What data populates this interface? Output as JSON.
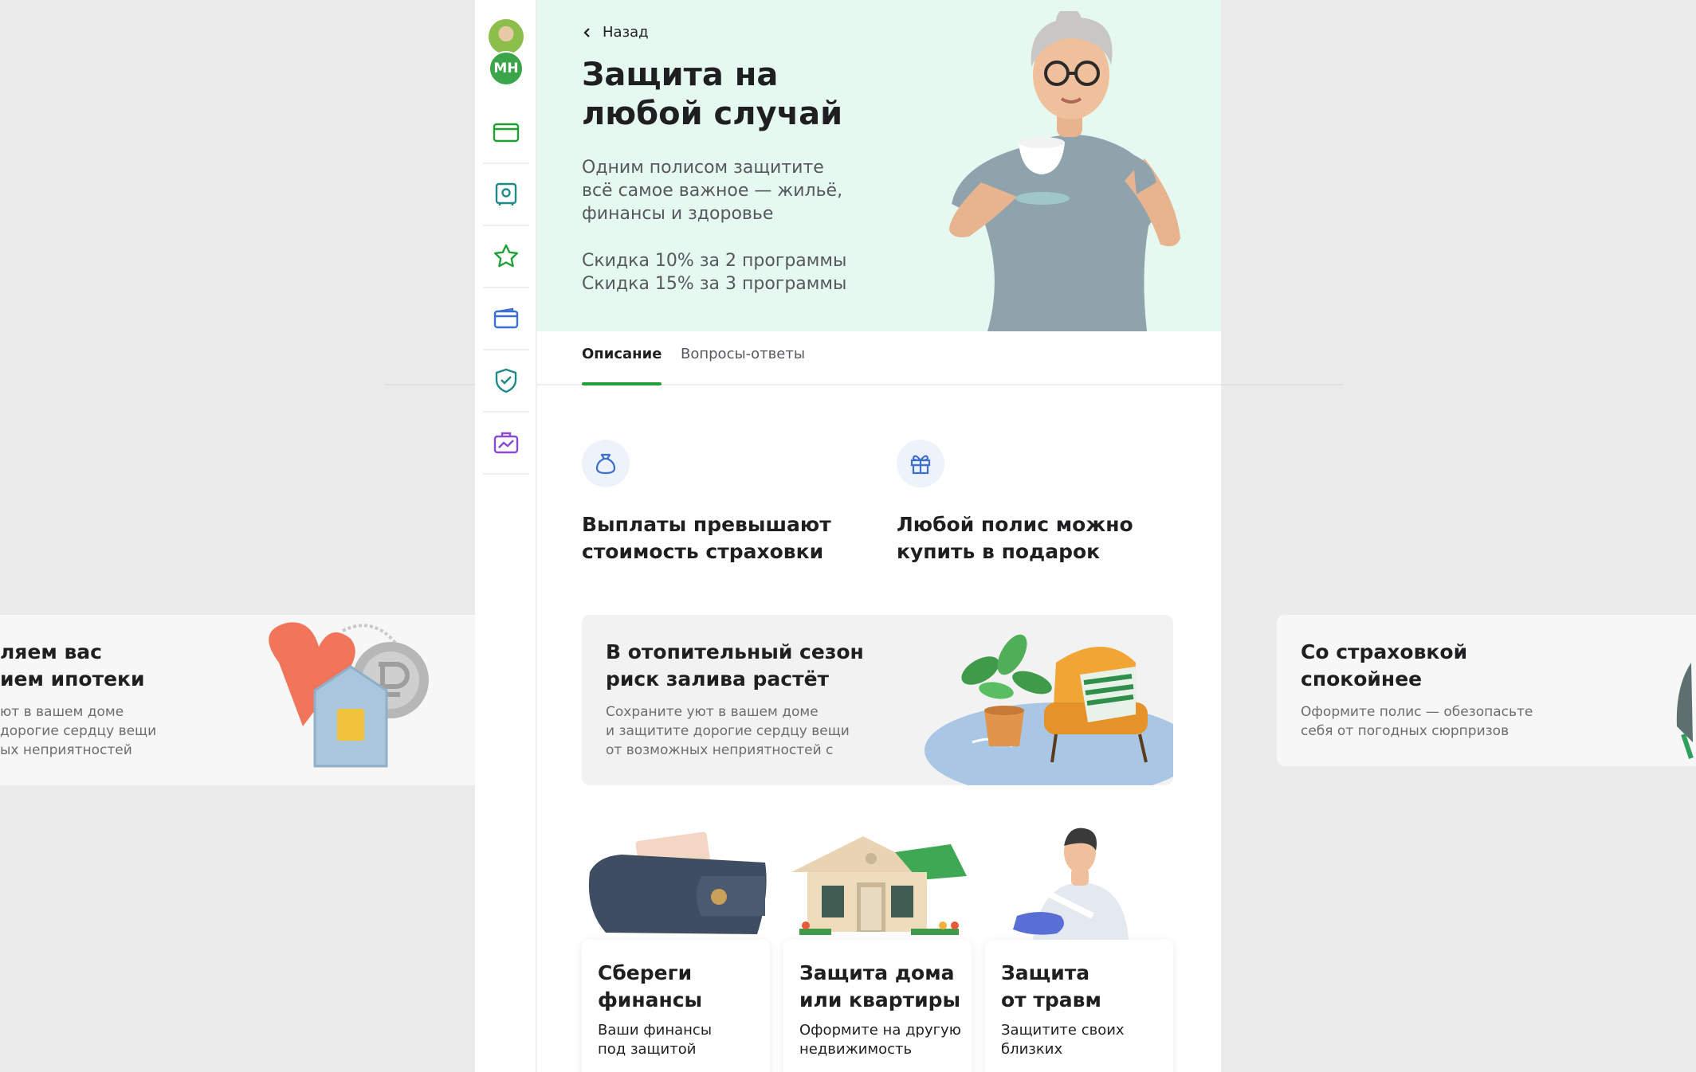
{
  "hero": {
    "back_label": "Назад",
    "title": "Защита на\nлюбой случай",
    "description": "Одним полисом защитите\nвсё самое важное — жильё,\nфинансы и здоровье",
    "discounts": [
      "Скидка 10% за 2 программы",
      "Скидка 15% за 3 программы"
    ]
  },
  "sidebar": {
    "avatar_initials": "МН",
    "items": [
      {
        "icon": "card-icon"
      },
      {
        "icon": "safe-icon"
      },
      {
        "icon": "star-icon"
      },
      {
        "icon": "wallet-icon"
      },
      {
        "icon": "shield-check-icon"
      },
      {
        "icon": "briefcase-chart-icon"
      }
    ]
  },
  "tabs": [
    {
      "label": "Описание",
      "active": true
    },
    {
      "label": "Вопросы-ответы",
      "active": false
    }
  ],
  "features": [
    {
      "icon": "money-bag-icon",
      "title": "Выплаты превышают\nстоимость страховки"
    },
    {
      "icon": "gift-icon",
      "title": "Любой полис можно\nкупить в подарок"
    }
  ],
  "banner": {
    "title": "В отопительный сезон\nриск залива растёт",
    "text": "Сохраните уют в вашем доме\nи защитите дорогие сердцу вещи\nот возможных неприятностей с"
  },
  "products": [
    {
      "title": "Сбереги\nфинансы",
      "subtitle": "Ваши финансы\nпод защитой"
    },
    {
      "title": "Защита дома\nили квартиры",
      "subtitle": "Оформите на другую\nнедвижимость"
    },
    {
      "title": "Защита\nот травм",
      "subtitle": "Защитите своих\nблизких"
    }
  ],
  "side_promos": {
    "left": {
      "title": "ляем вас\nием ипотеки",
      "text": "ют в вашем доме\nдорогие сердцу вещи\nых неприятностей"
    },
    "right": {
      "title": "Со страховкой\nспокойнее",
      "text": "Оформите полис — обезопасьте\nсебя от погодных сюрпризов"
    }
  },
  "colors": {
    "accent_green": "#21a038",
    "hero_bg": "#e6f9f1",
    "icon_blue": "#3b6fd0",
    "icon_purple": "#8a4bd3"
  }
}
